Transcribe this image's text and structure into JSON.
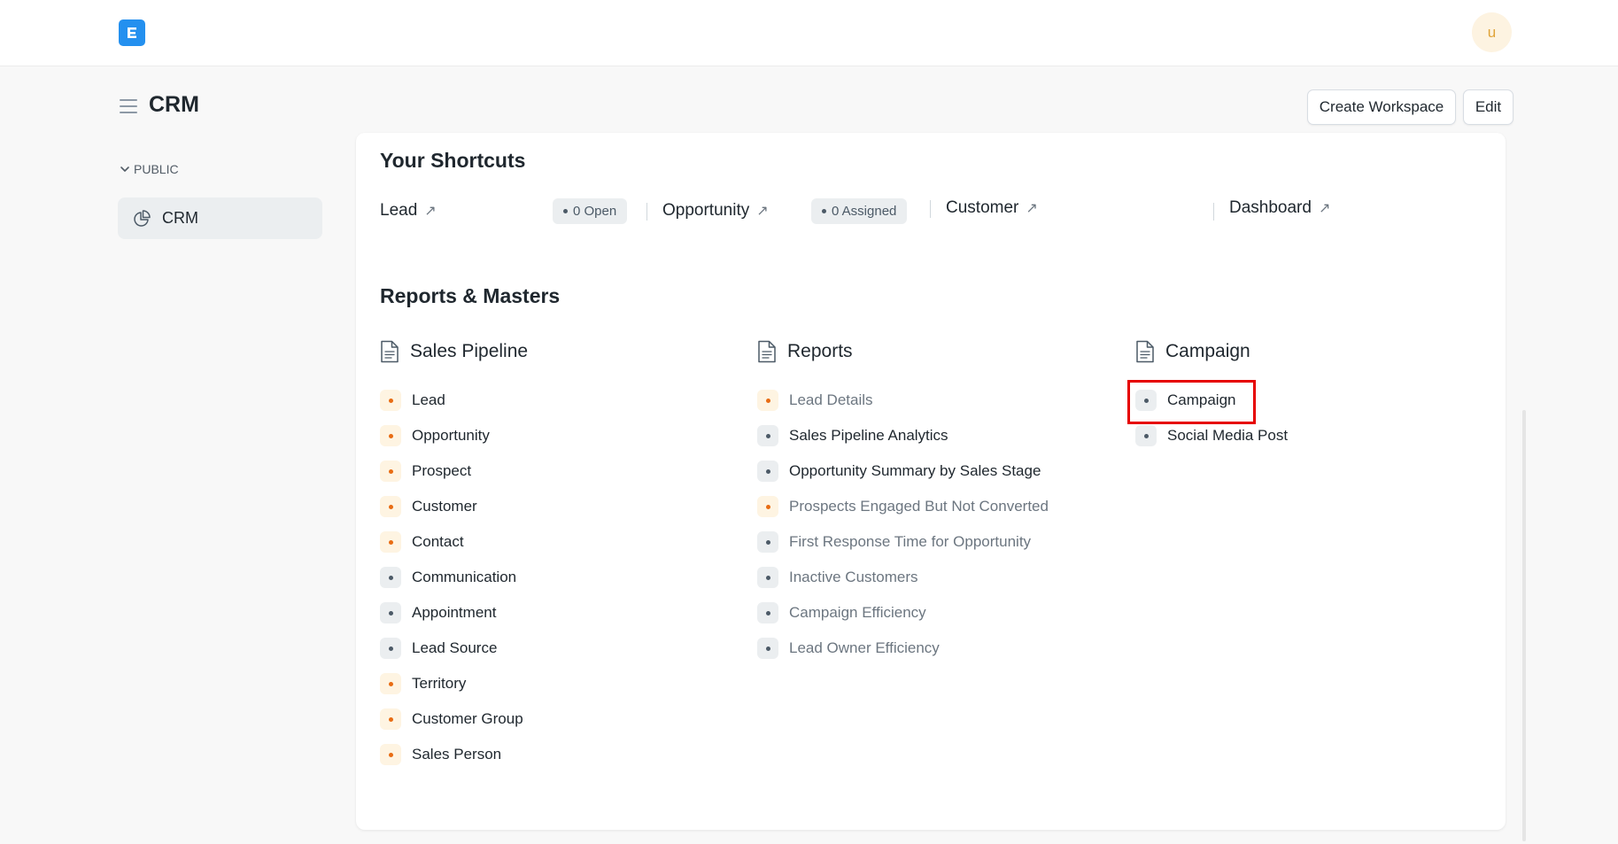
{
  "navbar": {
    "logo_letter": "E",
    "avatar_initial": "u"
  },
  "page": {
    "title": "CRM"
  },
  "actions": {
    "create_workspace": "Create Workspace",
    "edit": "Edit"
  },
  "sidebar": {
    "section_label": "PUBLIC",
    "items": [
      {
        "label": "CRM"
      }
    ]
  },
  "shortcuts": {
    "heading": "Your Shortcuts",
    "items": [
      {
        "label": "Lead",
        "badge": "0 Open"
      },
      {
        "label": "Opportunity",
        "badge": "0 Assigned"
      },
      {
        "label": "Customer"
      },
      {
        "label": "Dashboard"
      }
    ]
  },
  "reports": {
    "heading": "Reports & Masters",
    "columns": [
      {
        "title": "Sales Pipeline",
        "links": [
          {
            "label": "Lead",
            "style": "orange"
          },
          {
            "label": "Opportunity",
            "style": "orange"
          },
          {
            "label": "Prospect",
            "style": "orange"
          },
          {
            "label": "Customer",
            "style": "orange"
          },
          {
            "label": "Contact",
            "style": "orange"
          },
          {
            "label": "Communication",
            "style": "gray"
          },
          {
            "label": "Appointment",
            "style": "gray"
          },
          {
            "label": "Lead Source",
            "style": "gray"
          },
          {
            "label": "Territory",
            "style": "orange"
          },
          {
            "label": "Customer Group",
            "style": "orange"
          },
          {
            "label": "Sales Person",
            "style": "orange"
          }
        ]
      },
      {
        "title": "Reports",
        "links": [
          {
            "label": "Lead Details",
            "style": "orange"
          },
          {
            "label": "Sales Pipeline Analytics",
            "style": "gray"
          },
          {
            "label": "Opportunity Summary by Sales Stage",
            "style": "gray"
          },
          {
            "label": "Prospects Engaged But Not Converted",
            "style": "orange"
          },
          {
            "label": "First Response Time for Opportunity",
            "style": "gray"
          },
          {
            "label": "Inactive Customers",
            "style": "gray"
          },
          {
            "label": "Campaign Efficiency",
            "style": "gray"
          },
          {
            "label": "Lead Owner Efficiency",
            "style": "gray"
          }
        ]
      },
      {
        "title": "Campaign",
        "links": [
          {
            "label": "Campaign",
            "style": "gray"
          },
          {
            "label": "Social Media Post",
            "style": "gray"
          }
        ]
      }
    ]
  },
  "colors": {
    "brand": "#2490ef",
    "highlight": "#e60000",
    "bullet_orange": "#e86c13",
    "bullet_gray": "#4c5a67"
  }
}
